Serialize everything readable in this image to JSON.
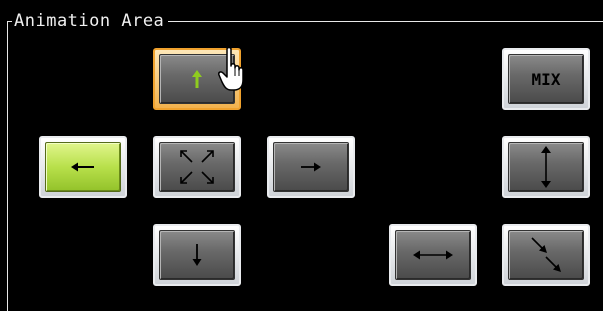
{
  "group": {
    "title": "Animation Area"
  },
  "buttons": [
    {
      "id": "up",
      "icon": "arrow-up-icon",
      "label": "",
      "state": "hover"
    },
    {
      "id": "mix",
      "icon": "",
      "label": "MIX",
      "state": "normal"
    },
    {
      "id": "left",
      "icon": "arrow-left-icon",
      "label": "",
      "state": "selected"
    },
    {
      "id": "expand",
      "icon": "expand-diagonal-icon",
      "label": "",
      "state": "normal"
    },
    {
      "id": "right",
      "icon": "arrow-right-icon",
      "label": "",
      "state": "normal"
    },
    {
      "id": "vertical",
      "icon": "arrow-up-down-icon",
      "label": "",
      "state": "normal"
    },
    {
      "id": "down",
      "icon": "arrow-down-icon",
      "label": "",
      "state": "normal"
    },
    {
      "id": "horizontal",
      "icon": "arrow-left-right-icon",
      "label": "",
      "state": "normal"
    },
    {
      "id": "diagonal",
      "icon": "arrow-diagonal-down-right-icon",
      "label": "",
      "state": "normal"
    }
  ],
  "colors": {
    "background": "#000000",
    "hover_border": "#f0a22e",
    "selected_face": "#b8e04b",
    "up_arrow": "#8fcc1f"
  },
  "cursor": {
    "icon": "hand-pointer-icon"
  }
}
